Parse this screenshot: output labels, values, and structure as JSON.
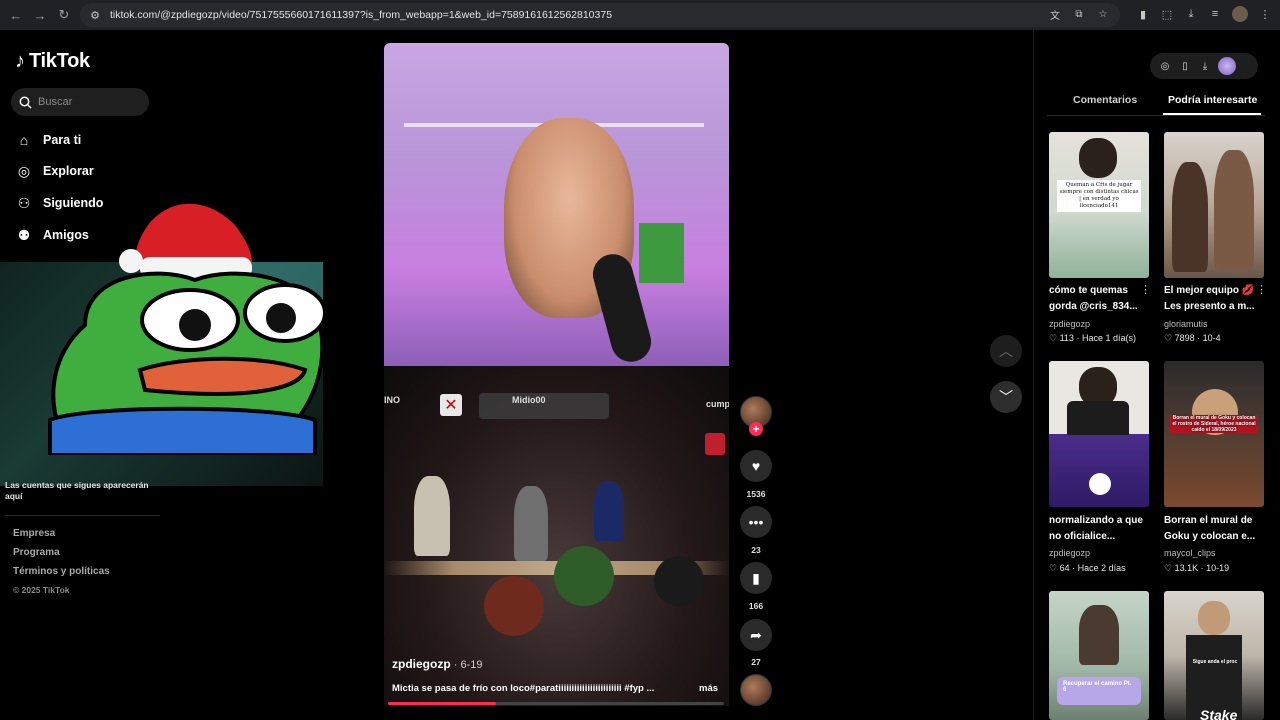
{
  "browser": {
    "url": "tiktok.com/@zpdiegozp/video/7517555660171611397?is_from_webapp=1&web_id=7589161612562810375"
  },
  "sidebar": {
    "logo_text": "TikTok",
    "search_placeholder": "Buscar",
    "items": [
      {
        "label": "Para ti",
        "icon": "home-icon"
      },
      {
        "label": "Explorar",
        "icon": "compass-icon"
      },
      {
        "label": "Siguiendo",
        "icon": "following-icon"
      },
      {
        "label": "Amigos",
        "icon": "friends-icon"
      }
    ],
    "following_hint": "Las cuentas que sigues aparecerán aquí",
    "footer": [
      "Empresa",
      "Programa",
      "Términos y políticas"
    ],
    "copyright": "© 2025 TikTok"
  },
  "video": {
    "game_labels": [
      "INO",
      "Midio00",
      "cumpl"
    ],
    "author": "zpdiegozp",
    "date": " · 6-19",
    "caption": "Mictia se pasa de frío con loco#paratiiiiiiiiiiiiiiiiiiiiiiii #fyp ...",
    "more_label": "más",
    "progress": 0.32
  },
  "actions": {
    "likes": "1536",
    "comments": "23",
    "saves": "166",
    "shares": "27"
  },
  "right": {
    "tabs": [
      "Comentarios",
      "Podría interesarte"
    ],
    "active_tab": "Podría interesarte",
    "cards": [
      {
        "title": "cómo te quemas gorda @cris_834...",
        "author": "zpdiegozp",
        "likes": "113",
        "age": "Hace 1 día(s)",
        "overlay": "Queman a Cris de jugar siempre con distintas chicas | en verdad yo licenciado141"
      },
      {
        "title": "El mejor equipo 💋 Les presento a m...",
        "author": "gloriamutis",
        "likes": "7898",
        "age": "10-4"
      },
      {
        "title": "normalizando a que no oficialice...",
        "author": "zpdiegozp",
        "likes": "64",
        "age": "Hace 2 días"
      },
      {
        "title": "Borran el mural de Goku y colocan e...",
        "author": "maycol_clips",
        "likes": "13.1K",
        "age": "10-19",
        "overlay": "Borran el mural de Goku y colocan el rostro de Sideral, héroe nacional caído el 18/09/2023"
      },
      {
        "overlay": "Recuperar el camino Pt. 6"
      },
      {
        "overlay": "Sigue anda el proc",
        "brand": "Stake"
      }
    ]
  },
  "colors": {
    "accent": "#fe2c55",
    "background": "#000000"
  }
}
